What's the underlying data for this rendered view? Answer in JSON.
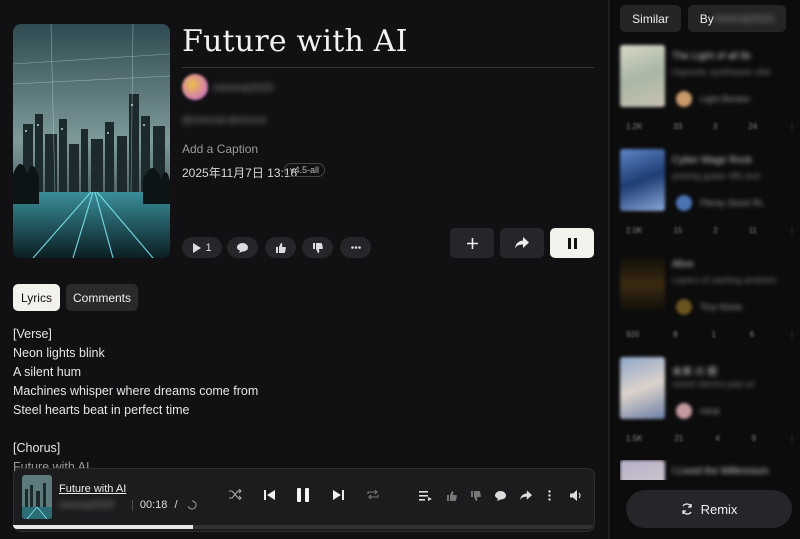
{
  "song": {
    "title": "Future with AI",
    "username": "mirenai2020",
    "handle": "@mirenai.deeoone",
    "caption_placeholder": "Add a Caption",
    "date": "2025年11月7日 13:16",
    "version": "v4.5-all",
    "play_count": "1"
  },
  "tabs": {
    "lyrics": "Lyrics",
    "comments": "Comments"
  },
  "lyrics": [
    "[Verse]",
    "Neon lights blink",
    "A silent hum",
    "Machines whisper where dreams come from",
    "Steel hearts beat in perfect time",
    "",
    "[Chorus]",
    "Future with AI"
  ],
  "player": {
    "title": "Future with AI",
    "artist": "mirenai2020",
    "time": "00:18",
    "separator": "/",
    "progress": 0.31
  },
  "sidebar": {
    "tabs": {
      "similar": "Similar",
      "by": "By",
      "by_user": "mirenai2020"
    },
    "remix_label": "Remix",
    "items": [
      {
        "title": "The Light of all lib",
        "subtitle": "Hypnotic synthwave vibe",
        "author": "Light Bonker",
        "stats": [
          "1.2K",
          "33",
          "3",
          "24"
        ]
      },
      {
        "title": "Cyber Mage Rock",
        "subtitle": "pulsing guitar riffs and",
        "author": "Plenty Stuck RL",
        "stats": [
          "2.0K",
          "15",
          "2",
          "11"
        ]
      },
      {
        "title": "Alive",
        "subtitle": "Layers of swirling ambient",
        "author": "Tiny Noise",
        "stats": [
          "920",
          "8",
          "1",
          "6"
        ]
      },
      {
        "title": "未来 の 歌",
        "subtitle": "sweet electro-pop w/",
        "author": "mirai",
        "stats": [
          "1.5K",
          "21",
          "4",
          "9"
        ]
      },
      {
        "title": "I Lived the Millennium",
        "subtitle": "",
        "author": "",
        "stats": []
      }
    ]
  }
}
